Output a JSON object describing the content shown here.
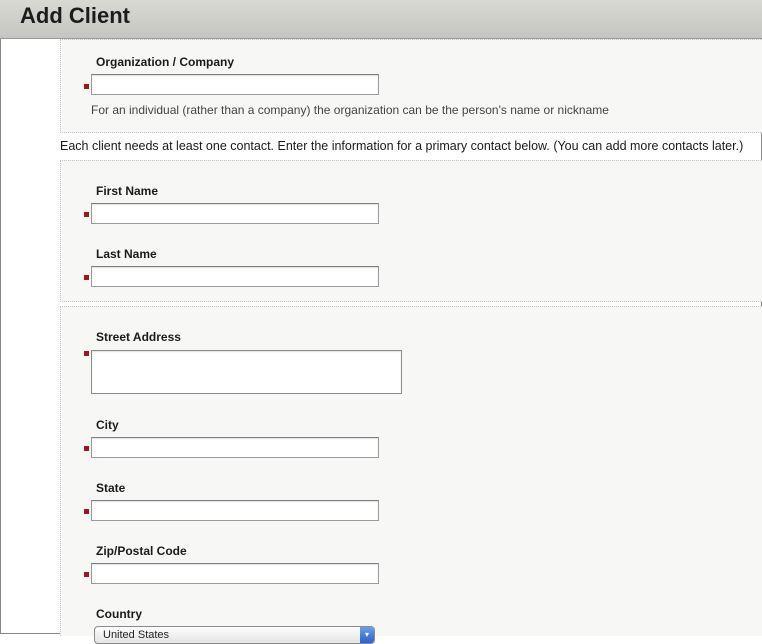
{
  "header": {
    "title": "Add Client"
  },
  "organization": {
    "label": "Organization / Company",
    "value": "",
    "hint": "For an individual (rather than a company) the organization can be the person's name or nickname"
  },
  "intro_text": "Each client needs at least one contact. Enter the information for a primary contact below. (You can add more contacts later.)",
  "contact": {
    "first_name_label": "First Name",
    "first_name_value": "",
    "last_name_label": "Last Name",
    "last_name_value": ""
  },
  "address": {
    "street_label": "Street Address",
    "street_value": "",
    "city_label": "City",
    "city_value": "",
    "state_label": "State",
    "state_value": "",
    "zip_label": "Zip/Postal Code",
    "zip_value": "",
    "country_label": "Country",
    "country_value": "United States"
  },
  "colors": {
    "required_marker": "#a3151b",
    "header_bg": "#cfcfca",
    "section_bg": "#f7f8f6"
  }
}
